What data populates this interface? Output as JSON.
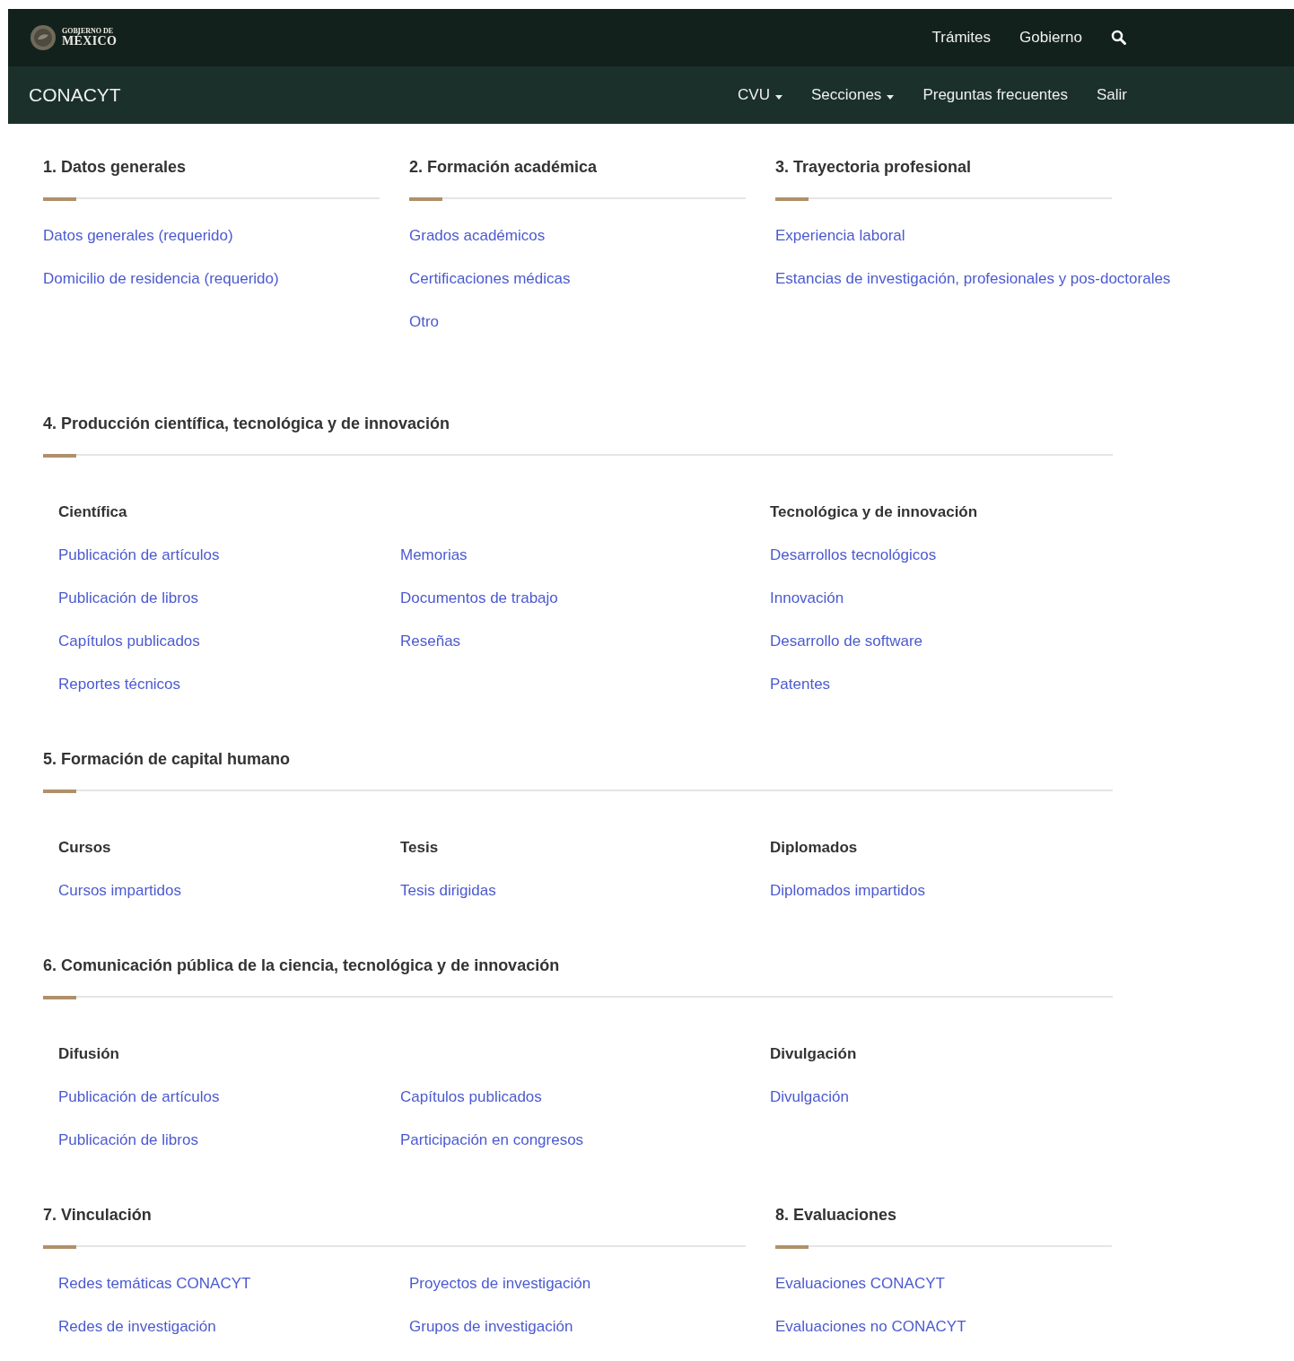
{
  "top_bar": {
    "logo": {
      "line1": "GOBIERNO DE",
      "line2": "MÉXICO"
    },
    "links": [
      "Trámites",
      "Gobierno"
    ]
  },
  "nav": {
    "brand": "CONACYT",
    "items": [
      {
        "label": "CVU",
        "dropdown": true
      },
      {
        "label": "Secciones",
        "dropdown": true
      },
      {
        "label": "Preguntas frecuentes",
        "dropdown": false
      },
      {
        "label": "Salir",
        "dropdown": false
      }
    ]
  },
  "section_rows": [
    {
      "sections": [
        {
          "kind": "links",
          "title": "1. Datos generales",
          "links": [
            "Datos generales (requerido)",
            "Domicilio de residencia (requerido)"
          ]
        },
        {
          "kind": "links",
          "title": "2. Formación académica",
          "links": [
            "Grados académicos",
            "Certificaciones médicas",
            "Otro"
          ]
        },
        {
          "kind": "links",
          "title": "3. Trayectoria profesional",
          "links": [
            "Experiencia laboral",
            "Estancias de investigación, profesionales y pos-doctorales"
          ]
        }
      ]
    },
    {
      "sections": [
        {
          "kind": "groups",
          "title": "4. Producción científica, tecnológica y de innovación",
          "groups": [
            {
              "heading": "Científica",
              "columns": [
                [
                  "Publicación de artículos",
                  "Publicación de libros",
                  "Capítulos publicados",
                  "Reportes técnicos"
                ],
                [
                  "Memorias",
                  "Documentos de trabajo",
                  "Reseñas"
                ]
              ]
            },
            {
              "heading": "Tecnológica y de innovación",
              "columns": [
                [
                  "Desarrollos tecnológicos",
                  "Innovación",
                  "Desarrollo de software",
                  "Patentes"
                ]
              ]
            }
          ]
        }
      ]
    },
    {
      "sections": [
        {
          "kind": "groups",
          "title": "5. Formación de capital humano",
          "groups": [
            {
              "heading": "Cursos",
              "columns": [
                [
                  "Cursos impartidos"
                ]
              ]
            },
            {
              "heading": "Tesis",
              "columns": [
                [
                  "Tesis dirigidas"
                ]
              ]
            },
            {
              "heading": "Diplomados",
              "columns": [
                [
                  "Diplomados impartidos"
                ]
              ]
            }
          ]
        }
      ]
    },
    {
      "sections": [
        {
          "kind": "groups",
          "title": "6. Comunicación pública de la ciencia, tecnológica y de innovación",
          "groups": [
            {
              "heading": "Difusión",
              "columns": [
                [
                  "Publicación de artículos",
                  "Publicación de libros"
                ],
                [
                  "Capítulos publicados",
                  "Participación en congresos"
                ]
              ]
            },
            {
              "heading": "Divulgación",
              "columns": [
                [
                  "Divulgación"
                ]
              ]
            }
          ]
        }
      ]
    },
    {
      "sections": [
        {
          "kind": "columns",
          "title": "7. Vinculación",
          "columns": [
            [
              "Redes temáticas CONACYT",
              "Redes de investigación"
            ],
            [
              "Proyectos de investigación",
              "Grupos de investigación"
            ]
          ]
        },
        {
          "kind": "links",
          "title": "8. Evaluaciones",
          "links": [
            "Evaluaciones CONACYT",
            "Evaluaciones no CONACYT"
          ]
        }
      ]
    }
  ]
}
